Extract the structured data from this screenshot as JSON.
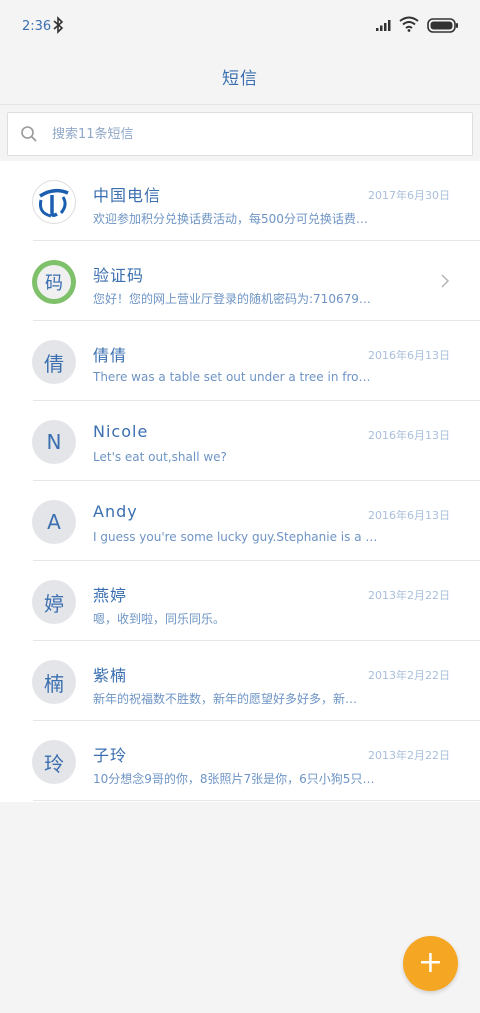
{
  "status_bar": {
    "time": "2:36"
  },
  "header": {
    "title": "短信"
  },
  "search": {
    "placeholder": "搜索11条短信"
  },
  "conversations": [
    {
      "avatar": "",
      "avatar_type": "telecom-logo",
      "sender": "中国电信",
      "date": "2017年6月30日",
      "preview": "欢迎参加积分兑换话费活动，每500分可兑换话费…"
    },
    {
      "avatar": "码",
      "avatar_type": "green",
      "sender": "验证码",
      "date": "",
      "preview": "您好！您的网上营业厅登录的随机密码为:710679…"
    },
    {
      "avatar": "倩",
      "avatar_type": "gray",
      "sender": "倩倩",
      "date": "2016年6月13日",
      "preview": "There was a table set out under a tree in fro…"
    },
    {
      "avatar": "N",
      "avatar_type": "gray",
      "sender": "Nicole",
      "date": "2016年6月13日",
      "preview": "Let's eat out,shall we?"
    },
    {
      "avatar": "A",
      "avatar_type": "gray",
      "sender": "Andy",
      "date": "2016年6月13日",
      "preview": "I guess you're some lucky guy.Stephanie is a …"
    },
    {
      "avatar": "婷",
      "avatar_type": "gray",
      "sender": "燕婷",
      "date": "2013年2月22日",
      "preview": "嗯，收到啦，同乐同乐。"
    },
    {
      "avatar": "楠",
      "avatar_type": "gray",
      "sender": "紫楠",
      "date": "2013年2月22日",
      "preview": "新年的祝福数不胜数，新年的愿望好多好多，新…"
    },
    {
      "avatar": "玲",
      "avatar_type": "gray",
      "sender": "子玲",
      "date": "2013年2月22日",
      "preview": "10分想念9哥的你，8张照片7张是你，6只小狗5只…"
    }
  ],
  "fab": {
    "label": "+"
  },
  "colors": {
    "accent": "#3b6fb0",
    "fab": "#f5a623",
    "avatar_green": "#7fc06a"
  }
}
